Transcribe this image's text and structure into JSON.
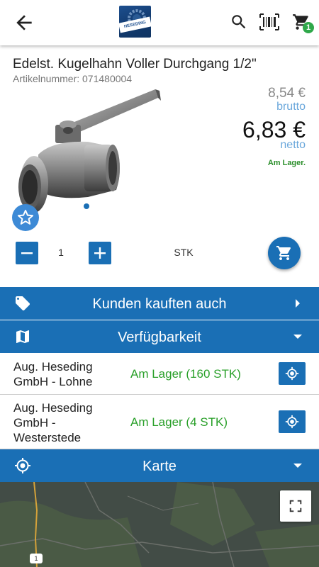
{
  "appbar": {
    "logo_text": "HESEDING",
    "cart_count": "1"
  },
  "product": {
    "title": "Edelst. Kugelhahn Voller Durchgang 1/2\"",
    "article_number": "Artikelnummer: 071480004",
    "price_brutto": "8,54 €",
    "label_brutto": "brutto",
    "price_netto": "6,83 €",
    "label_netto": "netto",
    "stock_status": "Am Lager."
  },
  "quantity": {
    "value": "1",
    "unit": "STK"
  },
  "sections": {
    "customers_also_bought": "Kunden kauften auch",
    "availability": "Verfügbarkeit",
    "map": "Karte"
  },
  "availability": [
    {
      "store": "Aug. Heseding GmbH - Lohne",
      "status": "Am Lager (160 STK)"
    },
    {
      "store": "Aug. Heseding GmbH - Westerstede",
      "status": "Am Lager (4 STK)"
    }
  ],
  "map": {
    "road_label": "1"
  },
  "colors": {
    "primary": "#1a6fb5",
    "in_stock": "#2aa02a",
    "price_label": "#6aa7db",
    "badge": "#2fa84a"
  }
}
